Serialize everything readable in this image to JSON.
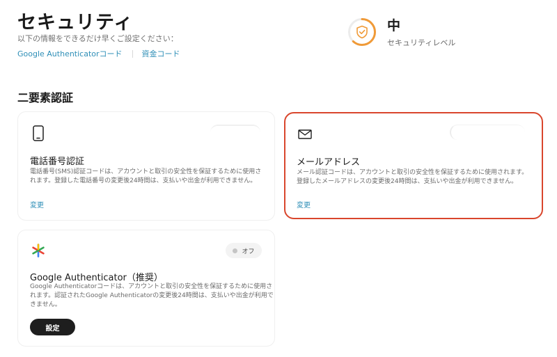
{
  "header": {
    "title": "セキュリティ",
    "subtitle": "以下の情報をできるだけ早くご設定ください：",
    "links": [
      "Google Authenticatorコード",
      "資金コード"
    ]
  },
  "security_level": {
    "value": "中",
    "label": "セキュリティレベル",
    "accent_color": "#f09a37",
    "progress_fraction": 0.62
  },
  "section": {
    "title": "二要素認証"
  },
  "cards": {
    "phone": {
      "title": "電話番号認証",
      "desc_line1": "電話番号(SMS)認証コードは、アカウントと取引の安全性を保証するために使用さ",
      "desc_line2": "れます。登録した電話番号の変更後24時間は、支払いや出金が利用できません。",
      "link": "変更",
      "icon": "smartphone-icon"
    },
    "email": {
      "title": "メールアドレス",
      "desc_line1": "メール認証コードは、アカウントと取引の安全性を保証するために使用されます。",
      "desc_line2": "登録したメールアドレスの変更後24時間は、支払いや出金が利用できません。",
      "link": "変更",
      "icon": "envelope-icon",
      "highlight_color": "#d9462c"
    },
    "ga": {
      "title": "Google Authenticator（推奨）",
      "desc_line1": "Google Authenticatorコードは、アカウントと取引の安全性を保証するために使用さ",
      "desc_line2": "れます。認証されたGoogle Authenticatorの変更後24時間は、支払いや出金が利用で",
      "desc_line3": "きません。",
      "toggle_label": "オフ",
      "button": "設定",
      "icon": "google-authenticator-icon"
    }
  }
}
